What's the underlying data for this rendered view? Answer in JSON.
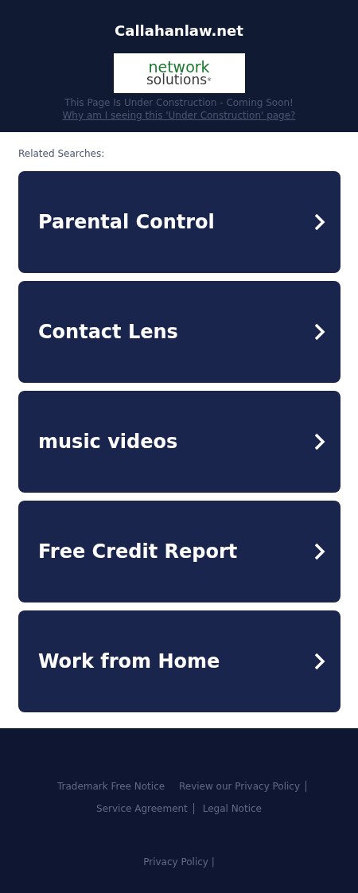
{
  "header": {
    "title": "Callahanlaw.net",
    "logo": {
      "line_1": "network",
      "line_2": "solutions",
      "mark": "®"
    },
    "notice": "This Page Is Under Construction - Coming Soon!",
    "notice_link": "Why am I seeing this 'Under Construction' page?"
  },
  "related_searches": {
    "label": "Related Searches:",
    "items": [
      {
        "label": "Parental Control"
      },
      {
        "label": "Contact Lens"
      },
      {
        "label": "music videos"
      },
      {
        "label": "Free Credit Report"
      },
      {
        "label": "Work from Home"
      }
    ]
  },
  "footer": {
    "links": [
      {
        "label": "Trademark Free Notice",
        "separated": false
      },
      {
        "label": "Review our Privacy Policy",
        "separated": true
      },
      {
        "label": "Service Agreement",
        "separated": true
      },
      {
        "label": "Legal Notice",
        "separated": false
      }
    ],
    "bottom_link": "Privacy Policy |"
  }
}
